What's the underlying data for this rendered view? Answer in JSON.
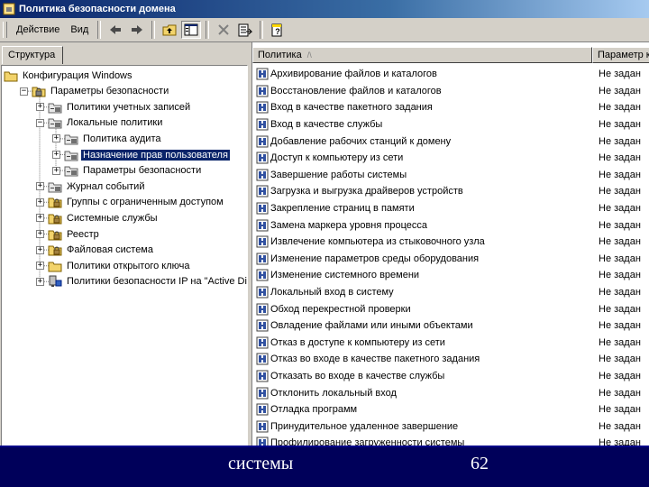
{
  "window": {
    "title": "Политика безопасности домена"
  },
  "menu": {
    "action": "Действие",
    "view": "Вид"
  },
  "left_pane": {
    "tab": "Структура",
    "tree": [
      {
        "label": "Конфигурация Windows",
        "indent": 0,
        "expander": "",
        "icon": "folder-icon"
      },
      {
        "label": "Параметры безопасности",
        "indent": 1,
        "expander": "−",
        "icon": "security-settings-icon"
      },
      {
        "label": "Политики учетных записей",
        "indent": 2,
        "expander": "+",
        "icon": "policy-folder-icon"
      },
      {
        "label": "Локальные политики",
        "indent": 2,
        "expander": "−",
        "icon": "policy-folder-icon"
      },
      {
        "label": "Политика аудита",
        "indent": 3,
        "expander": "+",
        "icon": "policy-folder-icon"
      },
      {
        "label": "Назначение прав пользователя",
        "indent": 3,
        "expander": "+",
        "icon": "policy-folder-icon",
        "selected": true
      },
      {
        "label": "Параметры безопасности",
        "indent": 3,
        "expander": "+",
        "icon": "policy-folder-icon"
      },
      {
        "label": "Журнал событий",
        "indent": 2,
        "expander": "+",
        "icon": "policy-folder-icon"
      },
      {
        "label": "Группы с ограниченным доступом",
        "indent": 2,
        "expander": "+",
        "icon": "restricted-groups-icon"
      },
      {
        "label": "Системные службы",
        "indent": 2,
        "expander": "+",
        "icon": "restricted-groups-icon"
      },
      {
        "label": "Реестр",
        "indent": 2,
        "expander": "+",
        "icon": "restricted-groups-icon"
      },
      {
        "label": "Файловая система",
        "indent": 2,
        "expander": "+",
        "icon": "restricted-groups-icon"
      },
      {
        "label": "Политики открытого ключа",
        "indent": 2,
        "expander": "+",
        "icon": "folder-icon"
      },
      {
        "label": "Политики безопасности IP на \"Active Directo",
        "indent": 2,
        "expander": "+",
        "icon": "ip-security-icon"
      }
    ]
  },
  "right_pane": {
    "columns": {
      "policy": "Политика",
      "setting": "Параметр ко"
    },
    "rows": [
      {
        "policy": "Архивирование файлов и каталогов",
        "setting": "Не задан"
      },
      {
        "policy": "Восстановление файлов и каталогов",
        "setting": "Не задан"
      },
      {
        "policy": "Вход в качестве пакетного задания",
        "setting": "Не задан"
      },
      {
        "policy": "Вход в качестве службы",
        "setting": "Не задан"
      },
      {
        "policy": "Добавление рабочих станций к домену",
        "setting": "Не задан"
      },
      {
        "policy": "Доступ к компьютеру из сети",
        "setting": "Не задан"
      },
      {
        "policy": "Завершение работы системы",
        "setting": "Не задан"
      },
      {
        "policy": "Загрузка и выгрузка драйверов устройств",
        "setting": "Не задан"
      },
      {
        "policy": "Закрепление страниц в памяти",
        "setting": "Не задан"
      },
      {
        "policy": "Замена маркера уровня процесса",
        "setting": "Не задан"
      },
      {
        "policy": "Извлечение компьютера из стыковочного узла",
        "setting": "Не задан"
      },
      {
        "policy": "Изменение параметров среды оборудования",
        "setting": "Не задан"
      },
      {
        "policy": "Изменение системного времени",
        "setting": "Не задан"
      },
      {
        "policy": "Локальный вход в систему",
        "setting": "Не задан"
      },
      {
        "policy": "Обход перекрестной проверки",
        "setting": "Не задан"
      },
      {
        "policy": "Овладение файлами или иными объектами",
        "setting": "Не задан"
      },
      {
        "policy": "Отказ в доступе к компьютеру из сети",
        "setting": "Не задан"
      },
      {
        "policy": "Отказ во входе в качестве пакетного задания",
        "setting": "Не задан"
      },
      {
        "policy": "Отказать во входе в качестве службы",
        "setting": "Не задан"
      },
      {
        "policy": "Отклонить локальный вход",
        "setting": "Не задан"
      },
      {
        "policy": "Отладка программ",
        "setting": "Не задан"
      },
      {
        "policy": "Принудительное удаленное завершение",
        "setting": "Не задан"
      },
      {
        "policy": "Профилирование загруженности системы",
        "setting": "Не задан"
      }
    ]
  },
  "banner": {
    "text": "системы",
    "page_number": "62"
  }
}
